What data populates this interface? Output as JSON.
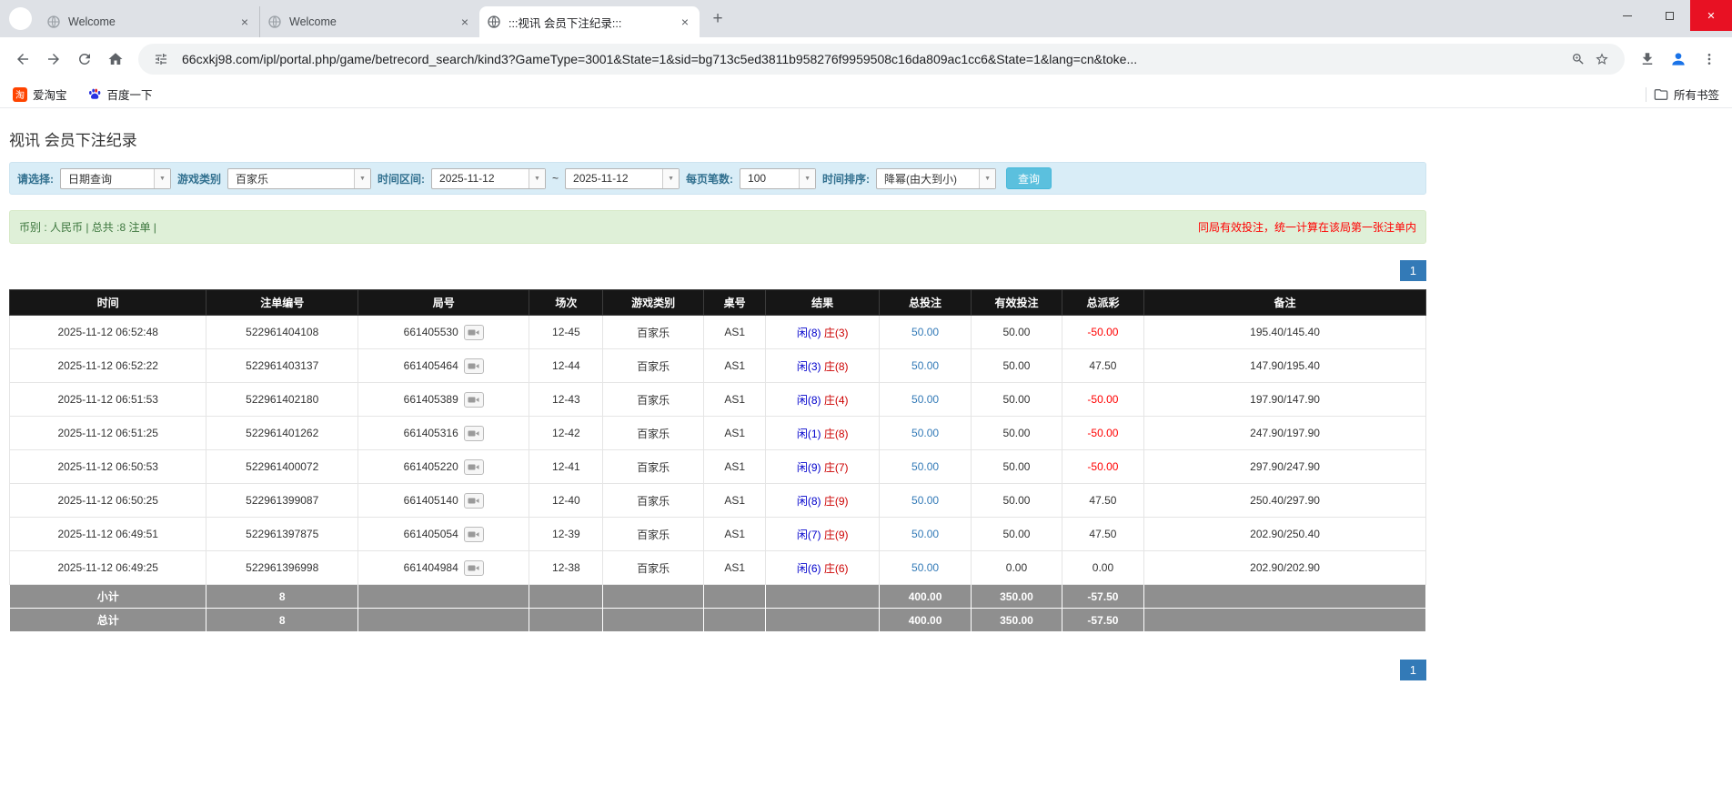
{
  "colors": {
    "accent_blue": "#337ab7",
    "filter_bar_bg": "#d9edf7",
    "summary_bar_bg": "#dff0d8",
    "table_header_bg": "#161616",
    "table_footer_bg": "#8f8f8f",
    "alert_red": "#ff0000",
    "player_blue": "#0000cc",
    "banker_red": "#cc0000",
    "search_button_bg": "#5bc0de",
    "taobao_red": "#ff4400",
    "close_button_red": "#e81123"
  },
  "icons": {
    "tab_close": "×",
    "window_close": "✕",
    "new_tab": "+",
    "caret": "▼"
  },
  "browser": {
    "tabs": [
      {
        "label": "Welcome"
      },
      {
        "label": "Welcome"
      },
      {
        "label": ":::视讯 会员下注纪录:::"
      }
    ],
    "url": "66cxkj98.com/ipl/portal.php/game/betrecord_search/kind3?GameType=3001&State=1&sid=bg713c5ed3811b958276f9959508c16da809ac1cc6&State=1&lang=cn&toke...",
    "bookmarks": {
      "taobao_label": "爱淘宝",
      "taobao_icon_char": "淘",
      "baidu_label": "百度一下",
      "all_bookmarks_label": "所有书签"
    }
  },
  "page": {
    "title": "视讯 会员下注纪录",
    "filters": {
      "select_label": "请选择:",
      "select_value": "日期查询",
      "game_type_label": "游戏类别",
      "game_type_value": "百家乐",
      "date_range_label": "时间区间:",
      "date_from": "2025-11-12",
      "date_separator": "~",
      "date_to": "2025-11-12",
      "page_size_label": "每页笔数:",
      "page_size_value": "100",
      "sort_label": "时间排序:",
      "sort_value": "降幂(由大到小)",
      "search_button_label": "查询"
    },
    "summary": {
      "left_text": "币别 : 人民币 | 总共 :8 注单 |",
      "right_text": "同局有效投注，统一计算在该局第一张注单内"
    },
    "pagination": {
      "current_page": "1"
    },
    "table": {
      "headers": [
        "时间",
        "注单编号",
        "局号",
        "场次",
        "游戏类别",
        "桌号",
        "结果",
        "总投注",
        "有效投注",
        "总派彩",
        "备注"
      ],
      "rows": [
        {
          "time": "2025-11-12 06:52:48",
          "bet_id": "522961404108",
          "round_id": "661405530",
          "session": "12-45",
          "game": "百家乐",
          "table": "AS1",
          "result_player": "闲(8)",
          "result_banker": "庄(3)",
          "total_bet": "50.00",
          "valid_bet": "50.00",
          "payout": "-50.00",
          "note": "195.40/145.40"
        },
        {
          "time": "2025-11-12 06:52:22",
          "bet_id": "522961403137",
          "round_id": "661405464",
          "session": "12-44",
          "game": "百家乐",
          "table": "AS1",
          "result_player": "闲(3)",
          "result_banker": "庄(8)",
          "total_bet": "50.00",
          "valid_bet": "50.00",
          "payout": "47.50",
          "note": "147.90/195.40"
        },
        {
          "time": "2025-11-12 06:51:53",
          "bet_id": "522961402180",
          "round_id": "661405389",
          "session": "12-43",
          "game": "百家乐",
          "table": "AS1",
          "result_player": "闲(8)",
          "result_banker": "庄(4)",
          "total_bet": "50.00",
          "valid_bet": "50.00",
          "payout": "-50.00",
          "note": "197.90/147.90"
        },
        {
          "time": "2025-11-12 06:51:25",
          "bet_id": "522961401262",
          "round_id": "661405316",
          "session": "12-42",
          "game": "百家乐",
          "table": "AS1",
          "result_player": "闲(1)",
          "result_banker": "庄(8)",
          "total_bet": "50.00",
          "valid_bet": "50.00",
          "payout": "-50.00",
          "note": "247.90/197.90"
        },
        {
          "time": "2025-11-12 06:50:53",
          "bet_id": "522961400072",
          "round_id": "661405220",
          "session": "12-41",
          "game": "百家乐",
          "table": "AS1",
          "result_player": "闲(9)",
          "result_banker": "庄(7)",
          "total_bet": "50.00",
          "valid_bet": "50.00",
          "payout": "-50.00",
          "note": "297.90/247.90"
        },
        {
          "time": "2025-11-12 06:50:25",
          "bet_id": "522961399087",
          "round_id": "661405140",
          "session": "12-40",
          "game": "百家乐",
          "table": "AS1",
          "result_player": "闲(8)",
          "result_banker": "庄(9)",
          "total_bet": "50.00",
          "valid_bet": "50.00",
          "payout": "47.50",
          "note": "250.40/297.90"
        },
        {
          "time": "2025-11-12 06:49:51",
          "bet_id": "522961397875",
          "round_id": "661405054",
          "session": "12-39",
          "game": "百家乐",
          "table": "AS1",
          "result_player": "闲(7)",
          "result_banker": "庄(9)",
          "total_bet": "50.00",
          "valid_bet": "50.00",
          "payout": "47.50",
          "note": "202.90/250.40"
        },
        {
          "time": "2025-11-12 06:49:25",
          "bet_id": "522961396998",
          "round_id": "661404984",
          "session": "12-38",
          "game": "百家乐",
          "table": "AS1",
          "result_player": "闲(6)",
          "result_banker": "庄(6)",
          "total_bet": "50.00",
          "valid_bet": "0.00",
          "payout": "0.00",
          "note": "202.90/202.90"
        }
      ],
      "subtotal": {
        "label": "小计",
        "count": "8",
        "total_bet": "400.00",
        "valid_bet": "350.00",
        "payout": "-57.50"
      },
      "total": {
        "label": "总计",
        "count": "8",
        "total_bet": "400.00",
        "valid_bet": "350.00",
        "payout": "-57.50"
      }
    }
  }
}
